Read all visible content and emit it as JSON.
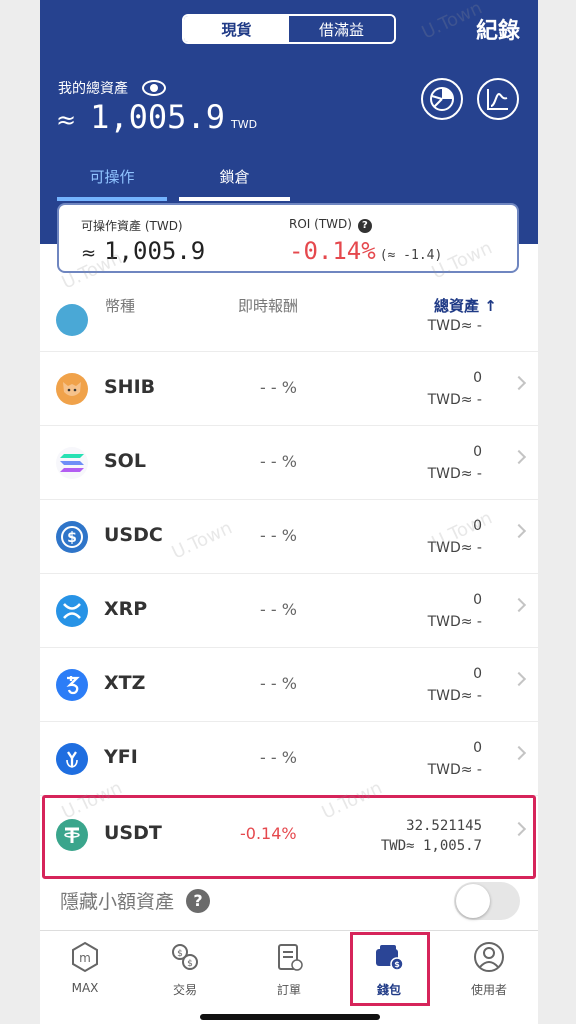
{
  "header": {
    "tabs": [
      "現貨",
      "借滿益"
    ],
    "records": "紀錄",
    "total_label": "我的總資產",
    "approx": "≈",
    "total_value": "1,005.9",
    "total_unit": "TWD",
    "sub_tabs": [
      "可操作",
      "鎖倉"
    ]
  },
  "summary": {
    "available_label": "可操作資產 (TWD)",
    "available_value": "1,005.9",
    "roi_label": "ROI (TWD)",
    "roi_value": "-0.14%",
    "roi_twd": "(≈ -1.4)"
  },
  "columns": {
    "coin": "幣種",
    "realtime": "即時報酬",
    "total": "總資產 ↑"
  },
  "partial_row": {
    "twd": "TWD≈ -"
  },
  "rows": [
    {
      "symbol": "SHIB",
      "pct": "- - %",
      "amount": "0",
      "twd": "TWD≈ -"
    },
    {
      "symbol": "SOL",
      "pct": "- - %",
      "amount": "0",
      "twd": "TWD≈ -"
    },
    {
      "symbol": "USDC",
      "pct": "- - %",
      "amount": "0",
      "twd": "TWD≈ -"
    },
    {
      "symbol": "XRP",
      "pct": "- - %",
      "amount": "0",
      "twd": "TWD≈ -"
    },
    {
      "symbol": "XTZ",
      "pct": "- - %",
      "amount": "0",
      "twd": "TWD≈ -"
    },
    {
      "symbol": "YFI",
      "pct": "- - %",
      "amount": "0",
      "twd": "TWD≈ -"
    },
    {
      "symbol": "USDT",
      "pct": "-0.14%",
      "amount": "32.521145",
      "twd": "TWD≈ 1,005.7"
    }
  ],
  "hide_small": {
    "label": "隱藏小額資產",
    "enabled": false
  },
  "nav": [
    "MAX",
    "交易",
    "訂單",
    "錢包",
    "使用者"
  ],
  "watermark": "U.Town",
  "colors": {
    "brand": "#26428f",
    "negative": "#e5484d",
    "highlight": "#d6245a"
  }
}
